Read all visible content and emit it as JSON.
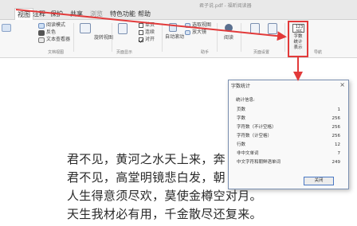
{
  "window": {
    "title": "君子说.pdf - 福昕阅读器"
  },
  "tabs": [
    {
      "label": "视图",
      "active": true
    },
    {
      "label": "注释",
      "active": false
    },
    {
      "label": "保护",
      "active": false
    },
    {
      "label": "共享",
      "active": false
    },
    {
      "label": "浏览",
      "active": false,
      "dim": true
    },
    {
      "label": "特色功能",
      "active": false
    },
    {
      "label": "帮助",
      "active": false
    }
  ],
  "ribbon": {
    "reading_mode": "阅读模式",
    "reverse_color": "反色",
    "text_viewer": "文本查看器",
    "doc_views_group": "文档视图",
    "rotate_view": "旋转视图",
    "page_display_group": "页面显示",
    "single_page": "单页",
    "continuous": "连续",
    "facing": "对开",
    "auto_scroll": "自动滚动",
    "magnifier": "选取视图",
    "loupe": "放大镜",
    "help_group": "助手",
    "dialog_tool": "阅读",
    "page_settings_group": "页面设置",
    "nav_group": "导航",
    "word_count_num": "123",
    "word_count_abc": "ABC",
    "word_count_label_1": "字数",
    "word_count_label_2": "统计",
    "word_count_label_3": "表示"
  },
  "document": {
    "lines": [
      "君不见，黄河之水天上来，奔",
      "君不见，高堂明镜悲白发，朝",
      "人生得意须尽欢，莫使金樽空对月。",
      "天生我材必有用，千金散尽还复来。"
    ]
  },
  "dialog": {
    "title": "字数统计",
    "subtitle": "统计信息:",
    "rows": [
      {
        "label": "页数",
        "value": "1"
      },
      {
        "label": "字数",
        "value": "256"
      },
      {
        "label": "字符数（不计空格）",
        "value": "256"
      },
      {
        "label": "字符数（计空格）",
        "value": "256"
      },
      {
        "label": "行数",
        "value": "12"
      },
      {
        "label": "非中文单词",
        "value": "7"
      },
      {
        "label": "中文字符和朝鲜语单词",
        "value": "249"
      }
    ],
    "close_button": "关闭"
  },
  "colors": {
    "highlight": "#e23a3a",
    "dialog_border": "#7a8fb0",
    "primary_button_border": "#4a78c4"
  }
}
